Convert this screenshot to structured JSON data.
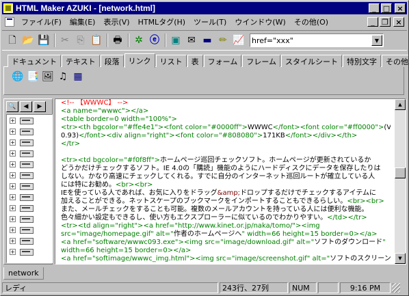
{
  "window": {
    "title": "HTML Maker AZUKI - [network.html]",
    "controls": {
      "minimize": "_",
      "maximize": "□",
      "close": "×"
    }
  },
  "menu": {
    "items": [
      "ファイル(F)",
      "編集(E)",
      "表示(V)",
      "HTMLタグ(H)",
      "ツール(T)",
      "ウインドウ(W)",
      "その他(O)"
    ],
    "child_controls": {
      "minimize": "_",
      "restore": "❐",
      "close": "×"
    }
  },
  "toolbar": {
    "buttons": [
      {
        "name": "new-file-icon",
        "glyph": "🗋"
      },
      {
        "name": "open-folder-icon",
        "glyph": "📂"
      },
      {
        "name": "save-icon",
        "glyph": "💾"
      },
      {
        "name": "cut-icon",
        "glyph": "✂"
      },
      {
        "name": "copy-icon",
        "glyph": "⎘"
      },
      {
        "name": "paste-icon",
        "glyph": "📋"
      },
      {
        "name": "print-icon",
        "glyph": "🖶"
      },
      {
        "name": "find-icon",
        "glyph": "✲"
      },
      {
        "name": "browser-icon",
        "glyph": "ⓔ"
      },
      {
        "name": "image-icon",
        "glyph": "▣"
      },
      {
        "name": "mail-icon",
        "glyph": "✉"
      },
      {
        "name": "monitor-icon",
        "glyph": "▬"
      },
      {
        "name": "pencil-icon",
        "glyph": "✏"
      },
      {
        "name": "chart-icon",
        "glyph": "📈"
      }
    ],
    "search_value": "href=\"xxx\"",
    "combo_arrow": "▼"
  },
  "tabs": {
    "items": [
      "ドキュメント",
      "テキスト",
      "段落",
      "リンク",
      "リスト",
      "表",
      "フォーム",
      "フレーム",
      "スタイルシート",
      "特別文字",
      "その他"
    ],
    "active_index": 3,
    "icons": [
      {
        "name": "globe-icon",
        "glyph": "🌐"
      },
      {
        "name": "bookmark-list-icon",
        "glyph": "📑"
      },
      {
        "name": "color-image-icon",
        "glyph": "🖼"
      },
      {
        "name": "music-note-icon",
        "glyph": "♫"
      },
      {
        "name": "picture-icon",
        "glyph": "▦"
      }
    ]
  },
  "tree": {
    "tool_glyphs": {
      "find": "🔍",
      "prev": "◀",
      "next": "▶"
    },
    "row_count": 13,
    "expander": "+"
  },
  "editor": {
    "lines": [
      [
        {
          "t": "<!-- 【WWWC】 -->",
          "c": "c-comment"
        }
      ],
      [
        {
          "t": "<a name=\"wwwc\"></a>",
          "c": "c-tag"
        }
      ],
      [
        {
          "t": "<table border=0 width=\"100%\">",
          "c": "c-tag"
        }
      ],
      [
        {
          "t": "<tr><th bgcolor=\"#ffe4e1\"><font color=\"#0000ff\">",
          "c": "c-tag"
        },
        {
          "t": "WWWC",
          "c": "c-text"
        },
        {
          "t": "</font><font color=\"#ff0000\">",
          "c": "c-tag"
        },
        {
          "t": "(Ver",
          "c": "c-text"
        }
      ],
      [
        {
          "t": "0.93)",
          "c": "c-text"
        },
        {
          "t": "</font><div align=\"right\"><font color=\"#808080\">",
          "c": "c-tag"
        },
        {
          "t": "171KB",
          "c": "c-text"
        },
        {
          "t": "</font></div></th>",
          "c": "c-tag"
        }
      ],
      [
        {
          "t": "</tr>",
          "c": "c-tag"
        }
      ],
      [
        {
          "t": "",
          "c": "c-text"
        }
      ],
      [
        {
          "t": "<tr><td bgcolor=\"#f0f8ff\">",
          "c": "c-tag"
        },
        {
          "t": "ホームページ巡回チェックソフト。ホームページが更新されているか",
          "c": "c-text"
        }
      ],
      [
        {
          "t": "どうかだけチェックするソフト。IE 4.0の「購読」機能のようにハードディスクにデータを保存したりは",
          "c": "c-text"
        }
      ],
      [
        {
          "t": "しない。かなり高速にチェックしてくれる。すでに自分のインターネット巡回ルートが確立している人",
          "c": "c-text"
        }
      ],
      [
        {
          "t": "には特にお勧め。",
          "c": "c-text"
        },
        {
          "t": "<br><br>",
          "c": "c-tag"
        }
      ],
      [
        {
          "t": "IEを使っている人であれば、お気に入りをドラッグ",
          "c": "c-text"
        },
        {
          "t": "&amp;",
          "c": "c-amp"
        },
        {
          "t": "ドロップするだけでチェックするアイテムに",
          "c": "c-text"
        }
      ],
      [
        {
          "t": "加えることができる。ネットスケープのブックマークをインポートすることもできるらしい。",
          "c": "c-text"
        },
        {
          "t": "<br><br>",
          "c": "c-tag"
        }
      ],
      [
        {
          "t": "また、メールチェックをすることも可能。複数のメールアカウントを持っている人には便利な機能。",
          "c": "c-text"
        }
      ],
      [
        {
          "t": "色々細かい設定もできるし、使い方もエクスプローラーに似ているのでわかりやすい。",
          "c": "c-text"
        },
        {
          "t": "</td></tr>",
          "c": "c-tag"
        }
      ],
      [
        {
          "t": "<tr><td align=\"right\"><a href=\"http://www.kinet.or.jp/naka/tomo/\"><img",
          "c": "c-tag"
        }
      ],
      [
        {
          "t": "src=\"image/homepage.gif\" alt=\"",
          "c": "c-tag"
        },
        {
          "t": "作者のホームページへ",
          "c": "c-text"
        },
        {
          "t": "\" width=66 height=15 border=0></a>",
          "c": "c-tag"
        }
      ],
      [
        {
          "t": "<a href=\"software/wwwc093.exe\"><img src=\"image/download.gif\" alt=\"",
          "c": "c-tag"
        },
        {
          "t": "ソフトのダウンロード",
          "c": "c-text"
        },
        {
          "t": "\"",
          "c": "c-tag"
        }
      ],
      [
        {
          "t": "width=66 height=15 border=0></a>",
          "c": "c-tag"
        }
      ],
      [
        {
          "t": "<a href=\"softimage/wwwc_img.html\"><img src=\"image/screenshot.gif\" alt=\"",
          "c": "c-tag"
        },
        {
          "t": "ソフトのスクリーン",
          "c": "c-text"
        }
      ]
    ],
    "scroll_up": "▲",
    "scroll_down": "▼"
  },
  "doc_tabs": [
    "network"
  ],
  "status": {
    "ready": "レディ",
    "position": "243行、27列",
    "num": "NUM",
    "time": "9:16 PM"
  },
  "colors": {
    "titlebar": "#000080",
    "tag": "#008000",
    "comment": "#ff0000",
    "text": "#000000"
  }
}
